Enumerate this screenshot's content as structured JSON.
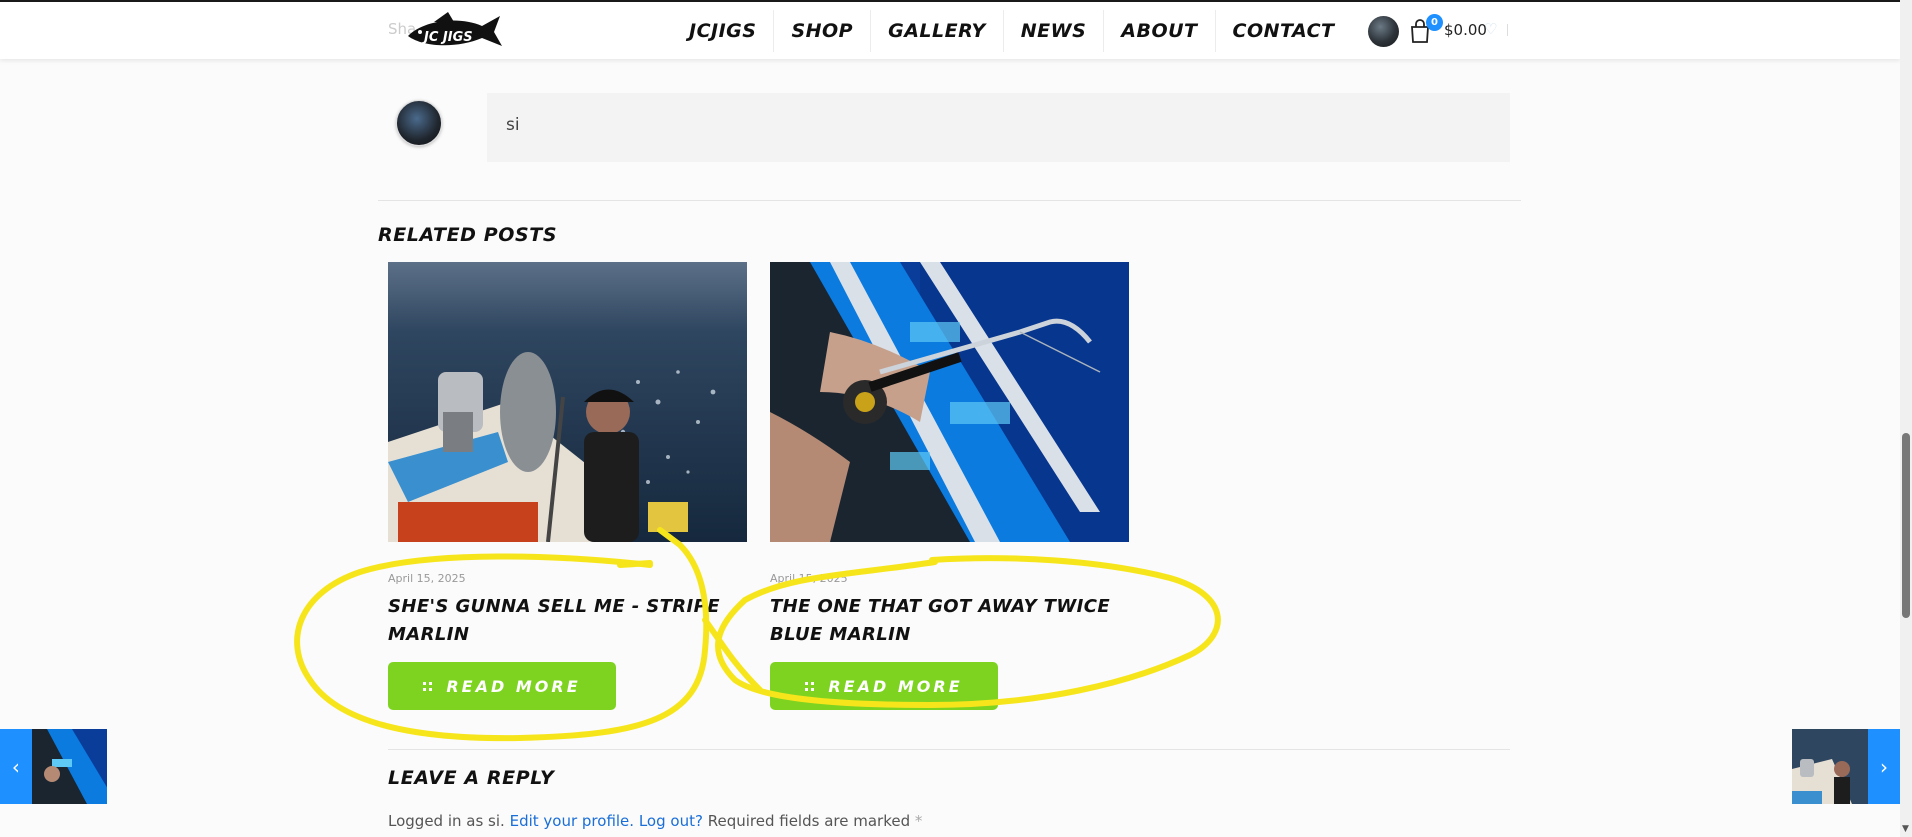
{
  "header": {
    "share_ghost": "Sha",
    "logo_text": "JC JIGS",
    "nav": [
      "JCJIGS",
      "SHOP",
      "GALLERY",
      "NEWS",
      "ABOUT",
      "CONTACT"
    ],
    "cart_count": "0",
    "cart_total": "$0.00"
  },
  "comment": {
    "text": "si"
  },
  "related": {
    "title": "Related posts",
    "posts": [
      {
        "date": "April 15, 2025",
        "title": "SHE'S GUNNA SELL ME - STRIPE MARLIN",
        "button": "READ MORE"
      },
      {
        "date": "April 15, 2025",
        "title": "THE ONE THAT GOT AWAY TWICE BLUE MARLIN",
        "button": "READ MORE"
      }
    ]
  },
  "reply": {
    "title": "Leave a Reply",
    "logged_in_prefix": "Logged in as si.",
    "edit_profile": "Edit your profile.",
    "logout": "Log out?",
    "required": "Required fields are marked",
    "required_mark": "*"
  },
  "post_nav": {
    "prev_arrow": "‹",
    "next_arrow": "›"
  },
  "colors": {
    "accent_green": "#7ed321",
    "accent_blue": "#1e90ff",
    "annotation_yellow": "#f7e51c"
  }
}
